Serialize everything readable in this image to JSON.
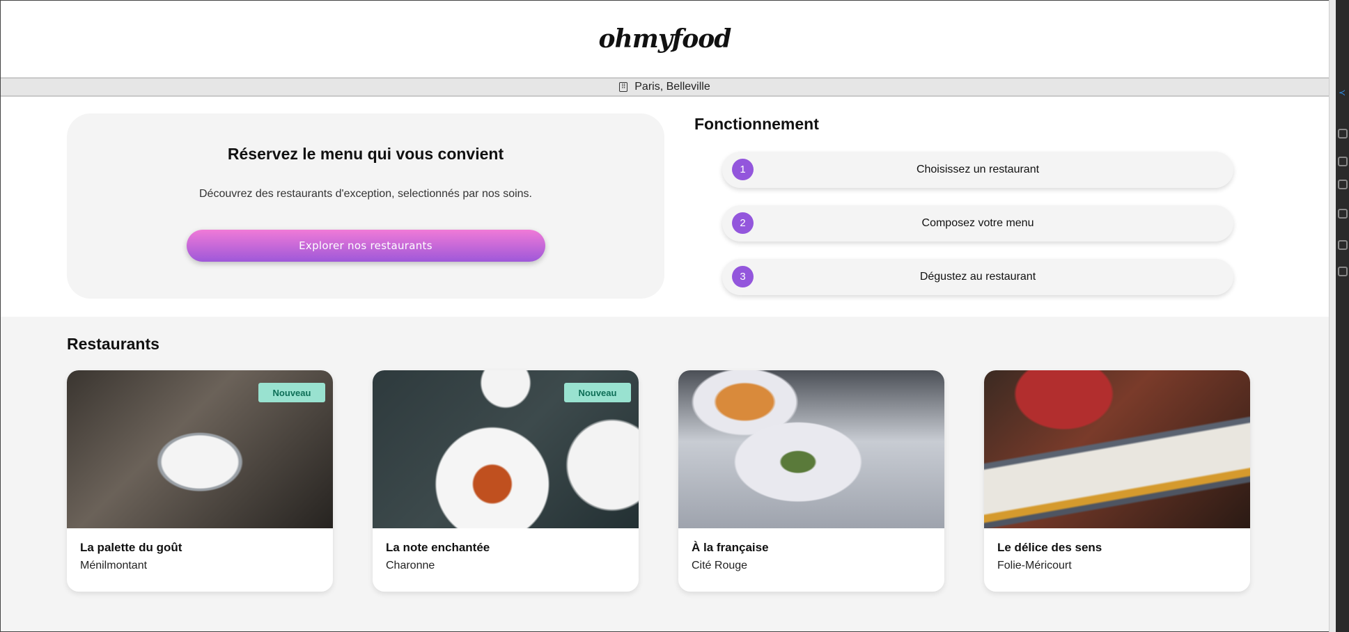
{
  "header": {
    "logo": "ohmyfood"
  },
  "location": {
    "icon": "map-pin-icon",
    "label": "Paris, Belleville"
  },
  "hero": {
    "title": "Réservez le menu qui vous convient",
    "subtitle": "Découvrez des restaurants d'exception, selectionnés par nos soins.",
    "cta_label": "Explorer nos restaurants"
  },
  "how": {
    "title": "Fonctionnement",
    "steps": [
      {
        "num": "1",
        "label": "Choisissez un restaurant"
      },
      {
        "num": "2",
        "label": "Composez votre menu"
      },
      {
        "num": "3",
        "label": "Dégustez au restaurant"
      }
    ]
  },
  "restaurants": {
    "title": "Restaurants",
    "items": [
      {
        "name": "La palette du goût",
        "area": "Ménilmontant",
        "badge": "Nouveau"
      },
      {
        "name": "La note enchantée",
        "area": "Charonne",
        "badge": "Nouveau"
      },
      {
        "name": "À la française",
        "area": "Cité Rouge"
      },
      {
        "name": "Le délice des sens",
        "area": "Folie-Méricourt"
      }
    ]
  },
  "colors": {
    "accent_start": "#f07ad7",
    "accent_end": "#9e58d9",
    "step_number": "#9356dc",
    "badge_bg": "#99e2d0",
    "badge_text": "#0e6e57"
  }
}
